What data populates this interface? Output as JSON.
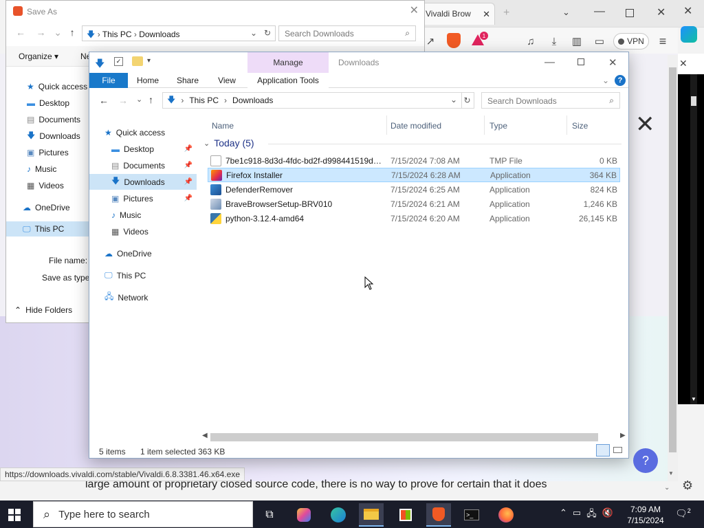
{
  "browser": {
    "tab_title": "Vivaldi Brow",
    "vpn_label": "VPN",
    "status_url": "https://downloads.vivaldi.com/stable/Vivaldi.6.8.3381.46.x64.exe",
    "page_text": "large amount of proprietary closed source code, there is no way to prove for certain that it does",
    "badge_count": "1"
  },
  "save_as": {
    "title": "Save As",
    "address": [
      "This PC",
      "Downloads"
    ],
    "search_placeholder": "Search Downloads",
    "organize": "Organize",
    "new_folder": "Ne",
    "nav": [
      "Quick access",
      "Desktop",
      "Documents",
      "Downloads",
      "Pictures",
      "Music",
      "Videos",
      "OneDrive",
      "This PC"
    ],
    "file_name_label": "File name:",
    "save_as_type_label": "Save as type:",
    "hide_folders": "Hide Folders"
  },
  "explorer": {
    "manage_tab": "Manage",
    "title": "Downloads",
    "ribbon_tabs": [
      "File",
      "Home",
      "Share",
      "View",
      "Application Tools"
    ],
    "address": [
      "This PC",
      "Downloads"
    ],
    "search_placeholder": "Search Downloads",
    "nav": {
      "quick_access": "Quick access",
      "desktop": "Desktop",
      "documents": "Documents",
      "downloads": "Downloads",
      "pictures": "Pictures",
      "music": "Music",
      "videos": "Videos",
      "onedrive": "OneDrive",
      "this_pc": "This PC",
      "network": "Network"
    },
    "columns": [
      "Name",
      "Date modified",
      "Type",
      "Size"
    ],
    "group": "Today (5)",
    "files": [
      {
        "name": "7be1c918-8d3d-4fdc-bd2f-d998441519dd...",
        "date": "7/15/2024 7:08 AM",
        "type": "TMP File",
        "size": "0 KB",
        "icon": "tmp-file-icon",
        "selected": false
      },
      {
        "name": "Firefox Installer",
        "date": "7/15/2024 6:28 AM",
        "type": "Application",
        "size": "364 KB",
        "icon": "firefox-installer-icon",
        "selected": true
      },
      {
        "name": "DefenderRemover",
        "date": "7/15/2024 6:25 AM",
        "type": "Application",
        "size": "824 KB",
        "icon": "defender-remover-icon",
        "selected": false
      },
      {
        "name": "BraveBrowserSetup-BRV010",
        "date": "7/15/2024 6:21 AM",
        "type": "Application",
        "size": "1,246 KB",
        "icon": "installer-icon",
        "selected": false
      },
      {
        "name": "python-3.12.4-amd64",
        "date": "7/15/2024 6:20 AM",
        "type": "Application",
        "size": "26,145 KB",
        "icon": "python-icon",
        "selected": false
      }
    ],
    "status": {
      "items": "5 items",
      "selected": "1 item selected",
      "size": "363 KB"
    }
  },
  "taskbar": {
    "search_placeholder": "Type here to search",
    "time": "7:09 AM",
    "date": "7/15/2024",
    "notifications": "2"
  },
  "colors": {
    "accent": "#1979ca",
    "selection": "#cce8ff",
    "manage": "#eedcf8",
    "taskbar": "#1a1d2a"
  }
}
